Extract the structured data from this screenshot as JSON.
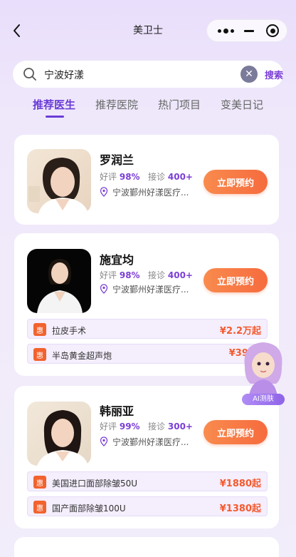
{
  "nav": {
    "title": "美卫士",
    "back_icon": "chevron-left-icon",
    "capsule_icons": [
      "more-dots-icon",
      "minimize-icon",
      "close-target-icon"
    ]
  },
  "search": {
    "value": "宁波好漾",
    "submit_label": "搜索",
    "clear_icon": "close-icon",
    "search_icon": "search-icon"
  },
  "tabs": [
    {
      "label": "推荐医生",
      "active": true
    },
    {
      "label": "推荐医院",
      "active": false
    },
    {
      "label": "热门项目",
      "active": false
    },
    {
      "label": "变美日记",
      "active": false
    }
  ],
  "doctors": [
    {
      "name": "罗润兰",
      "rating_label": "好评",
      "rating": "98%",
      "visits_label": "接诊",
      "visits": "400+",
      "hospital": "宁波鄞州好漾医疗...",
      "book_label": "立即预约",
      "projects": []
    },
    {
      "name": "施宜均",
      "rating_label": "好评",
      "rating": "98%",
      "visits_label": "接诊",
      "visits": "400+",
      "hospital": "宁波鄞州好漾医疗...",
      "book_label": "立即预约",
      "projects": [
        {
          "tag": "惠",
          "name": "拉皮手术",
          "price": "¥2.2万起"
        },
        {
          "tag": "惠",
          "name": "半岛黄金超声炮",
          "price": "¥3980"
        }
      ]
    },
    {
      "name": "韩丽亚",
      "rating_label": "好评",
      "rating": "99%",
      "visits_label": "接诊",
      "visits": "300+",
      "hospital": "宁波鄞州好漾医疗...",
      "book_label": "立即预约",
      "projects": [
        {
          "tag": "惠",
          "name": "美国进口面部除皱50U",
          "price": "¥1880起"
        },
        {
          "tag": "惠",
          "name": "国产面部除皱100U",
          "price": "¥1380起"
        }
      ]
    }
  ],
  "ai_widget": {
    "label": "AI测肤"
  },
  "colors": {
    "accent": "#6a3cd6",
    "price": "#f45a2e",
    "book_button": "#f66b3e"
  }
}
